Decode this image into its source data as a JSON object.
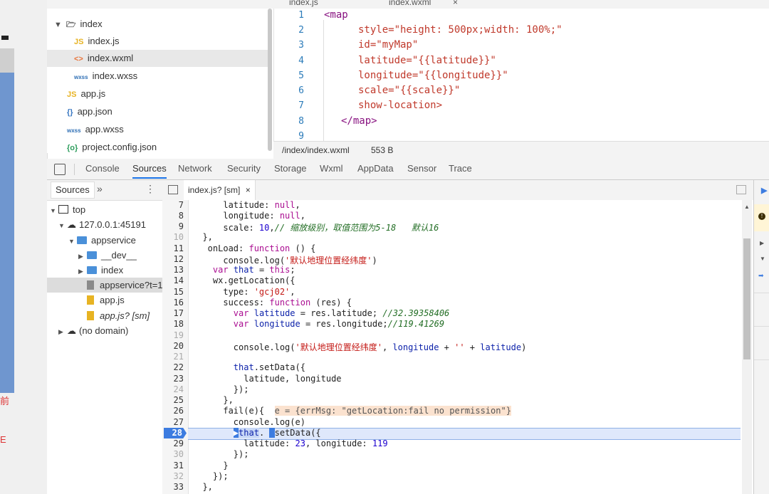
{
  "top_tabs": [
    "index.js",
    "index.wxml"
  ],
  "file_tree": {
    "items": [
      {
        "name": "index",
        "icon": "folder-open-icon",
        "indent": 0
      },
      {
        "name": "index.js",
        "icon_text": "JS"
      },
      {
        "name": "index.wxml",
        "icon_text": "<>"
      },
      {
        "name": "index.wxss",
        "icon_text": "wxss"
      },
      {
        "name": "app.js",
        "icon_text": "JS"
      },
      {
        "name": "app.json",
        "icon_text": "{}"
      },
      {
        "name": "app.wxss",
        "icon_text": "wxss"
      },
      {
        "name": "project.config.json",
        "icon_text": "{o}"
      }
    ]
  },
  "editor": {
    "line_numbers": [
      "1",
      "2",
      "3",
      "4",
      "5",
      "6",
      "7",
      "8",
      "9"
    ],
    "lines": [
      "<map",
      "style=\"height: 500px;width: 100%;\"",
      "id=\"myMap\"",
      "latitude=\"{{latitude}}\"",
      "longitude=\"{{longitude}}\"",
      "scale=\"{{scale}}\"",
      "show-location>",
      "</map>",
      ""
    ],
    "status_path": "/index/index.wxml",
    "status_size": "553 B"
  },
  "devtools_tabs": [
    "Console",
    "Sources",
    "Network",
    "Security",
    "Storage",
    "Wxml",
    "AppData",
    "Sensor",
    "Trace"
  ],
  "navigator": {
    "header": "Sources",
    "more": "»",
    "menu": "⋮",
    "tree": [
      {
        "label": "top"
      },
      {
        "label": "127.0.0.1:45191"
      },
      {
        "label": "appservice"
      },
      {
        "label": "__dev__"
      },
      {
        "label": "index"
      },
      {
        "label": "appservice?t=1"
      },
      {
        "label": "app.js"
      },
      {
        "label": "app.js? [sm]"
      },
      {
        "label": "(no domain)"
      }
    ]
  },
  "source_tab": {
    "label": "index.js? [sm]",
    "close": "×"
  },
  "source": {
    "line_numbers": [
      "7",
      "8",
      "9",
      "10",
      "11",
      "12",
      "13",
      "14",
      "15",
      "16",
      "17",
      "18",
      "19",
      "20",
      "21",
      "22",
      "23",
      "24",
      "25",
      "26",
      "27",
      "28",
      "29",
      "30",
      "31",
      "32",
      "33"
    ],
    "current_line": "28",
    "error_inline": "e = {errMsg: \"getLocation:fail no permission\"}"
  }
}
